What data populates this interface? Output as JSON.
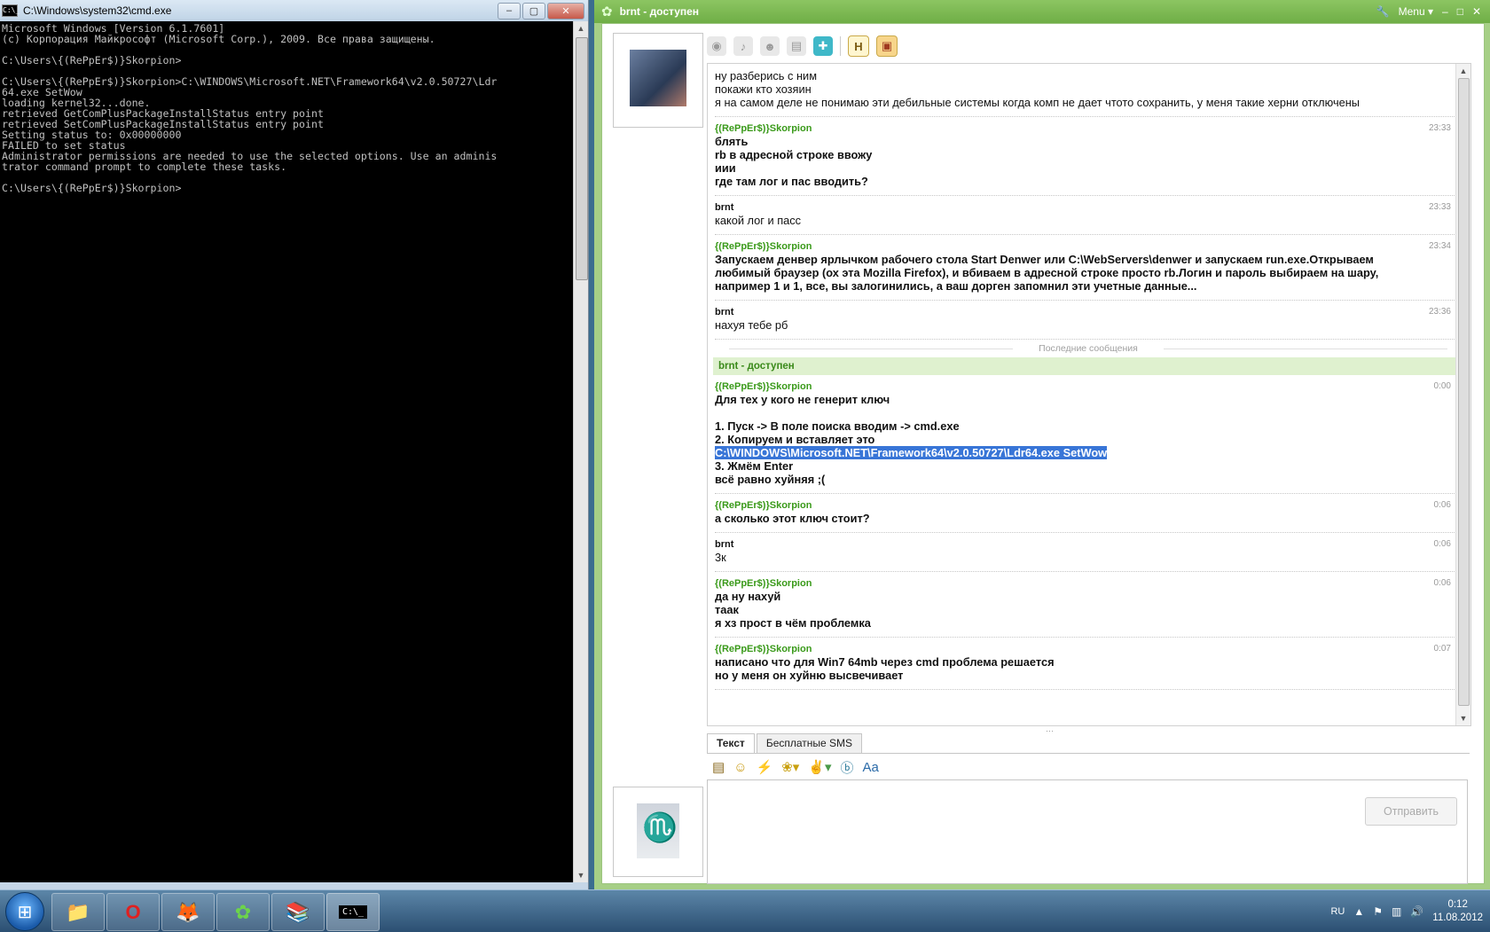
{
  "cmd": {
    "title": "C:\\Windows\\system32\\cmd.exe",
    "app_icon": "C:\\_",
    "controls": {
      "minimize": "–",
      "maximize": "▢",
      "close": "✕"
    },
    "output": "Microsoft Windows [Version 6.1.7601]\n(c) Корпорация Майкрософт (Microsoft Corp.), 2009. Все права защищены.\n\nC:\\Users\\{(RePpEr$)}Skorpion>\n\nC:\\Users\\{(RePpEr$)}Skorpion>C:\\WINDOWS\\Microsoft.NET\\Framework64\\v2.0.50727\\Ldr\n64.exe SetWow\nloading kernel32...done.\nretrieved GetComPlusPackageInstallStatus entry point\nretrieved SetComPlusPackageInstallStatus entry point\nSetting status to: 0x00000000\nFAILED to set status\nAdministrator permissions are needed to use the selected options. Use an adminis\ntrator command prompt to complete these tasks.\n\nC:\\Users\\{(RePpEr$)}Skorpion>"
  },
  "icq": {
    "title": "brnt - доступен",
    "menu_label": "Menu",
    "controls": {
      "minimize": "–",
      "maximize": "□",
      "close": "✕"
    },
    "toolbar_icons": [
      "webcam-icon",
      "microphone-icon",
      "contacts-icon",
      "history-icon",
      "games-icon",
      "h-icon",
      "card-icon"
    ],
    "messages": [
      {
        "sender": "",
        "time": "",
        "bold": false,
        "lines": [
          "ну разберись с ним",
          "покажи кто хозяин",
          "я на самом деле не понимаю эти дебильные системы когда комп не дает чтото сохранить, у меня такие херни отключены"
        ]
      },
      {
        "sender": "{(RePpEr$)}Skorpion",
        "sender_color": "green",
        "time": "23:33",
        "bold": true,
        "lines": [
          "блять",
          "rb в адресной строке ввожу",
          "иии",
          "где там лог и пас вводить?"
        ]
      },
      {
        "sender": "brnt",
        "sender_color": "black",
        "time": "23:33",
        "bold": false,
        "lines": [
          "какой лог и пасс"
        ]
      },
      {
        "sender": "{(RePpEr$)}Skorpion",
        "sender_color": "green",
        "time": "23:34",
        "bold": true,
        "lines": [
          "Запускаем денвер ярлычком рабочего стола Start Denwer или C:\\WebServers\\denwer и запускаем run.exe.Открываем",
          "любимый браузер (ох эта Mozilla Firefox), и вбиваем в адресной строке просто rb.Логин и пароль выбираем на шару,",
          "например 1 и 1, все, вы залогинились, а ваш дорген запомнил эти учетные данные..."
        ]
      },
      {
        "sender": "brnt",
        "sender_color": "black",
        "time": "23:36",
        "bold": false,
        "lines": [
          "нахуя тебе рб"
        ]
      }
    ],
    "divider_label": "Последние сообщения",
    "status_line": "brnt - доступен",
    "recent_messages": [
      {
        "sender": "{(RePpEr$)}Skorpion",
        "sender_color": "green",
        "time": "0:00",
        "bold": true,
        "lines": [
          "Для тех у кого не генерит ключ",
          "",
          "1. Пуск -> В поле поиска вводим -> cmd.exe",
          "2. Копируем и вставляет это"
        ],
        "selected_line": "C:\\WINDOWS\\Microsoft.NET\\Framework64\\v2.0.50727\\Ldr64.exe SetWow",
        "after_lines": [
          "3. Жмём Enter",
          "всё равно хуйняя ;("
        ]
      },
      {
        "sender": "{(RePpEr$)}Skorpion",
        "sender_color": "green",
        "time": "0:06",
        "bold": true,
        "lines": [
          "а сколько этот ключ стоит?"
        ]
      },
      {
        "sender": "brnt",
        "sender_color": "black",
        "time": "0:06",
        "bold": false,
        "lines": [
          "3к"
        ]
      },
      {
        "sender": "{(RePpEr$)}Skorpion",
        "sender_color": "green",
        "time": "0:06",
        "bold": true,
        "lines": [
          "да ну нахуй",
          "таак",
          "я хз прост в чём проблемка"
        ]
      },
      {
        "sender": "{(RePpEr$)}Skorpion",
        "sender_color": "green",
        "time": "0:07",
        "bold": true,
        "lines": [
          "написано что для Win7 64mb через cmd проблема решается",
          "но у меня он хуйню высвечивает"
        ]
      }
    ],
    "tabs": [
      {
        "label": "Текст",
        "active": true
      },
      {
        "label": "Бесплатные SMS",
        "active": false
      }
    ],
    "input_tools": [
      "paste-icon",
      "smiley-icon",
      "lightning-icon",
      "bee-icon",
      "fingers-icon",
      "b-icon",
      "font-icon"
    ],
    "input_value": "",
    "send_label": "Отправить"
  },
  "taskbar": {
    "apps": [
      "explorer-icon",
      "opera-icon",
      "firefox-icon",
      "icq-icon",
      "winrar-icon",
      "cmd-icon"
    ],
    "language": "RU",
    "time": "0:12",
    "date": "11.08.2012"
  },
  "colors": {
    "sender_green": "#3a9a1a",
    "selection": "#3875d7",
    "icq_frame": "#a6cf86"
  }
}
